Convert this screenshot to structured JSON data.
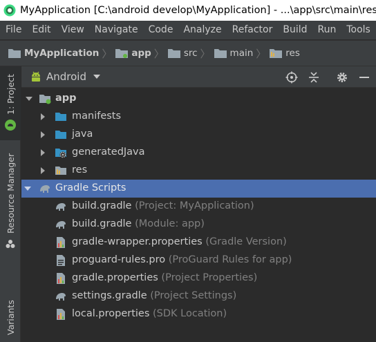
{
  "titlebar": {
    "title": "MyApplication [C:\\android develop\\MyApplication] - ...\\app\\src\\main\\res"
  },
  "menu": [
    "File",
    "Edit",
    "View",
    "Navigate",
    "Code",
    "Analyze",
    "Refactor",
    "Build",
    "Run",
    "Tools"
  ],
  "breadcrumb": [
    "MyApplication",
    "app",
    "src",
    "main",
    "res"
  ],
  "left_strip": {
    "project_tab": "1: Project",
    "resource_tab": "Resource Manager",
    "variants_tab": "Variants"
  },
  "project_view": {
    "view_mode": "Android"
  },
  "tree": {
    "app": "app",
    "manifests": "manifests",
    "java": "java",
    "generatedJava": "generatedJava",
    "res": "res",
    "gradle_scripts": "Gradle Scripts",
    "files": [
      {
        "name": "build.gradle",
        "hint": "(Project: MyApplication)"
      },
      {
        "name": "build.gradle",
        "hint": "(Module: app)"
      },
      {
        "name": "gradle-wrapper.properties",
        "hint": "(Gradle Version)"
      },
      {
        "name": "proguard-rules.pro",
        "hint": "(ProGuard Rules for app)"
      },
      {
        "name": "gradle.properties",
        "hint": "(Project Properties)"
      },
      {
        "name": "settings.gradle",
        "hint": "(Project Settings)"
      },
      {
        "name": "local.properties",
        "hint": "(SDK Location)"
      }
    ]
  },
  "colors": {
    "selection": "#4b6eaf",
    "folder_blue": "#3592c4",
    "android_green": "#a4c639",
    "panel": "#3c3f41",
    "editor_bg": "#2b2b2b"
  }
}
